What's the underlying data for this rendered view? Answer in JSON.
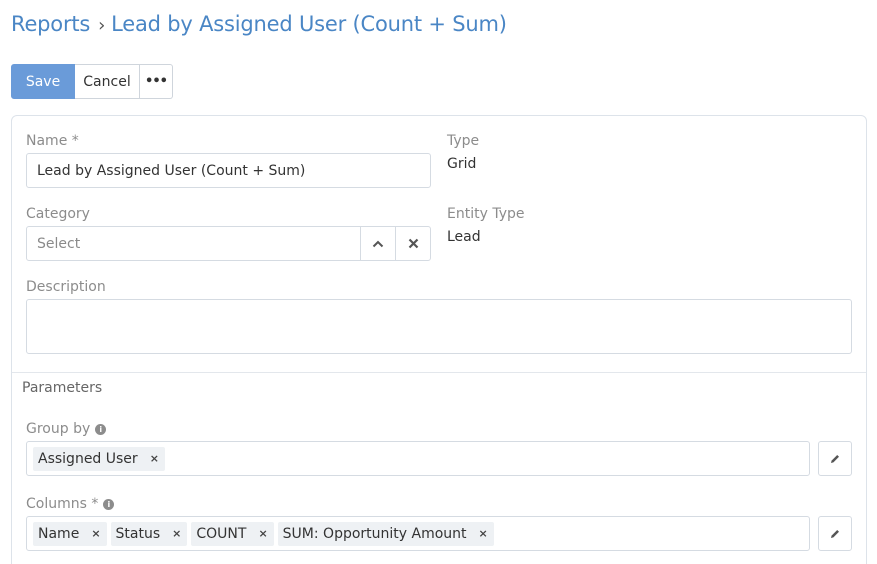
{
  "breadcrumb": {
    "root": "Reports",
    "separator": "›",
    "current": "Lead by Assigned User (Count + Sum)"
  },
  "toolbar": {
    "save_label": "Save",
    "cancel_label": "Cancel",
    "more_label": "•••"
  },
  "form": {
    "name_label": "Name *",
    "name_value": "Lead by Assigned User (Count + Sum)",
    "type_label": "Type",
    "type_value": "Grid",
    "category_label": "Category",
    "category_placeholder": "Select",
    "entity_type_label": "Entity Type",
    "entity_type_value": "Lead",
    "description_label": "Description",
    "description_value": ""
  },
  "parameters": {
    "title": "Parameters",
    "group_by_label": "Group by",
    "group_by_items": [
      "Assigned User"
    ],
    "columns_label": "Columns *",
    "columns_items": [
      "Name",
      "Status",
      "COUNT",
      "SUM: Opportunity Amount"
    ]
  },
  "icons": {
    "remove": "×",
    "info": "i",
    "chevron_up": "chevron-up-icon",
    "clear": "close-icon",
    "edit": "pencil-icon"
  },
  "colors": {
    "link": "#4a86c5",
    "primary_button": "#6a9bd9"
  }
}
